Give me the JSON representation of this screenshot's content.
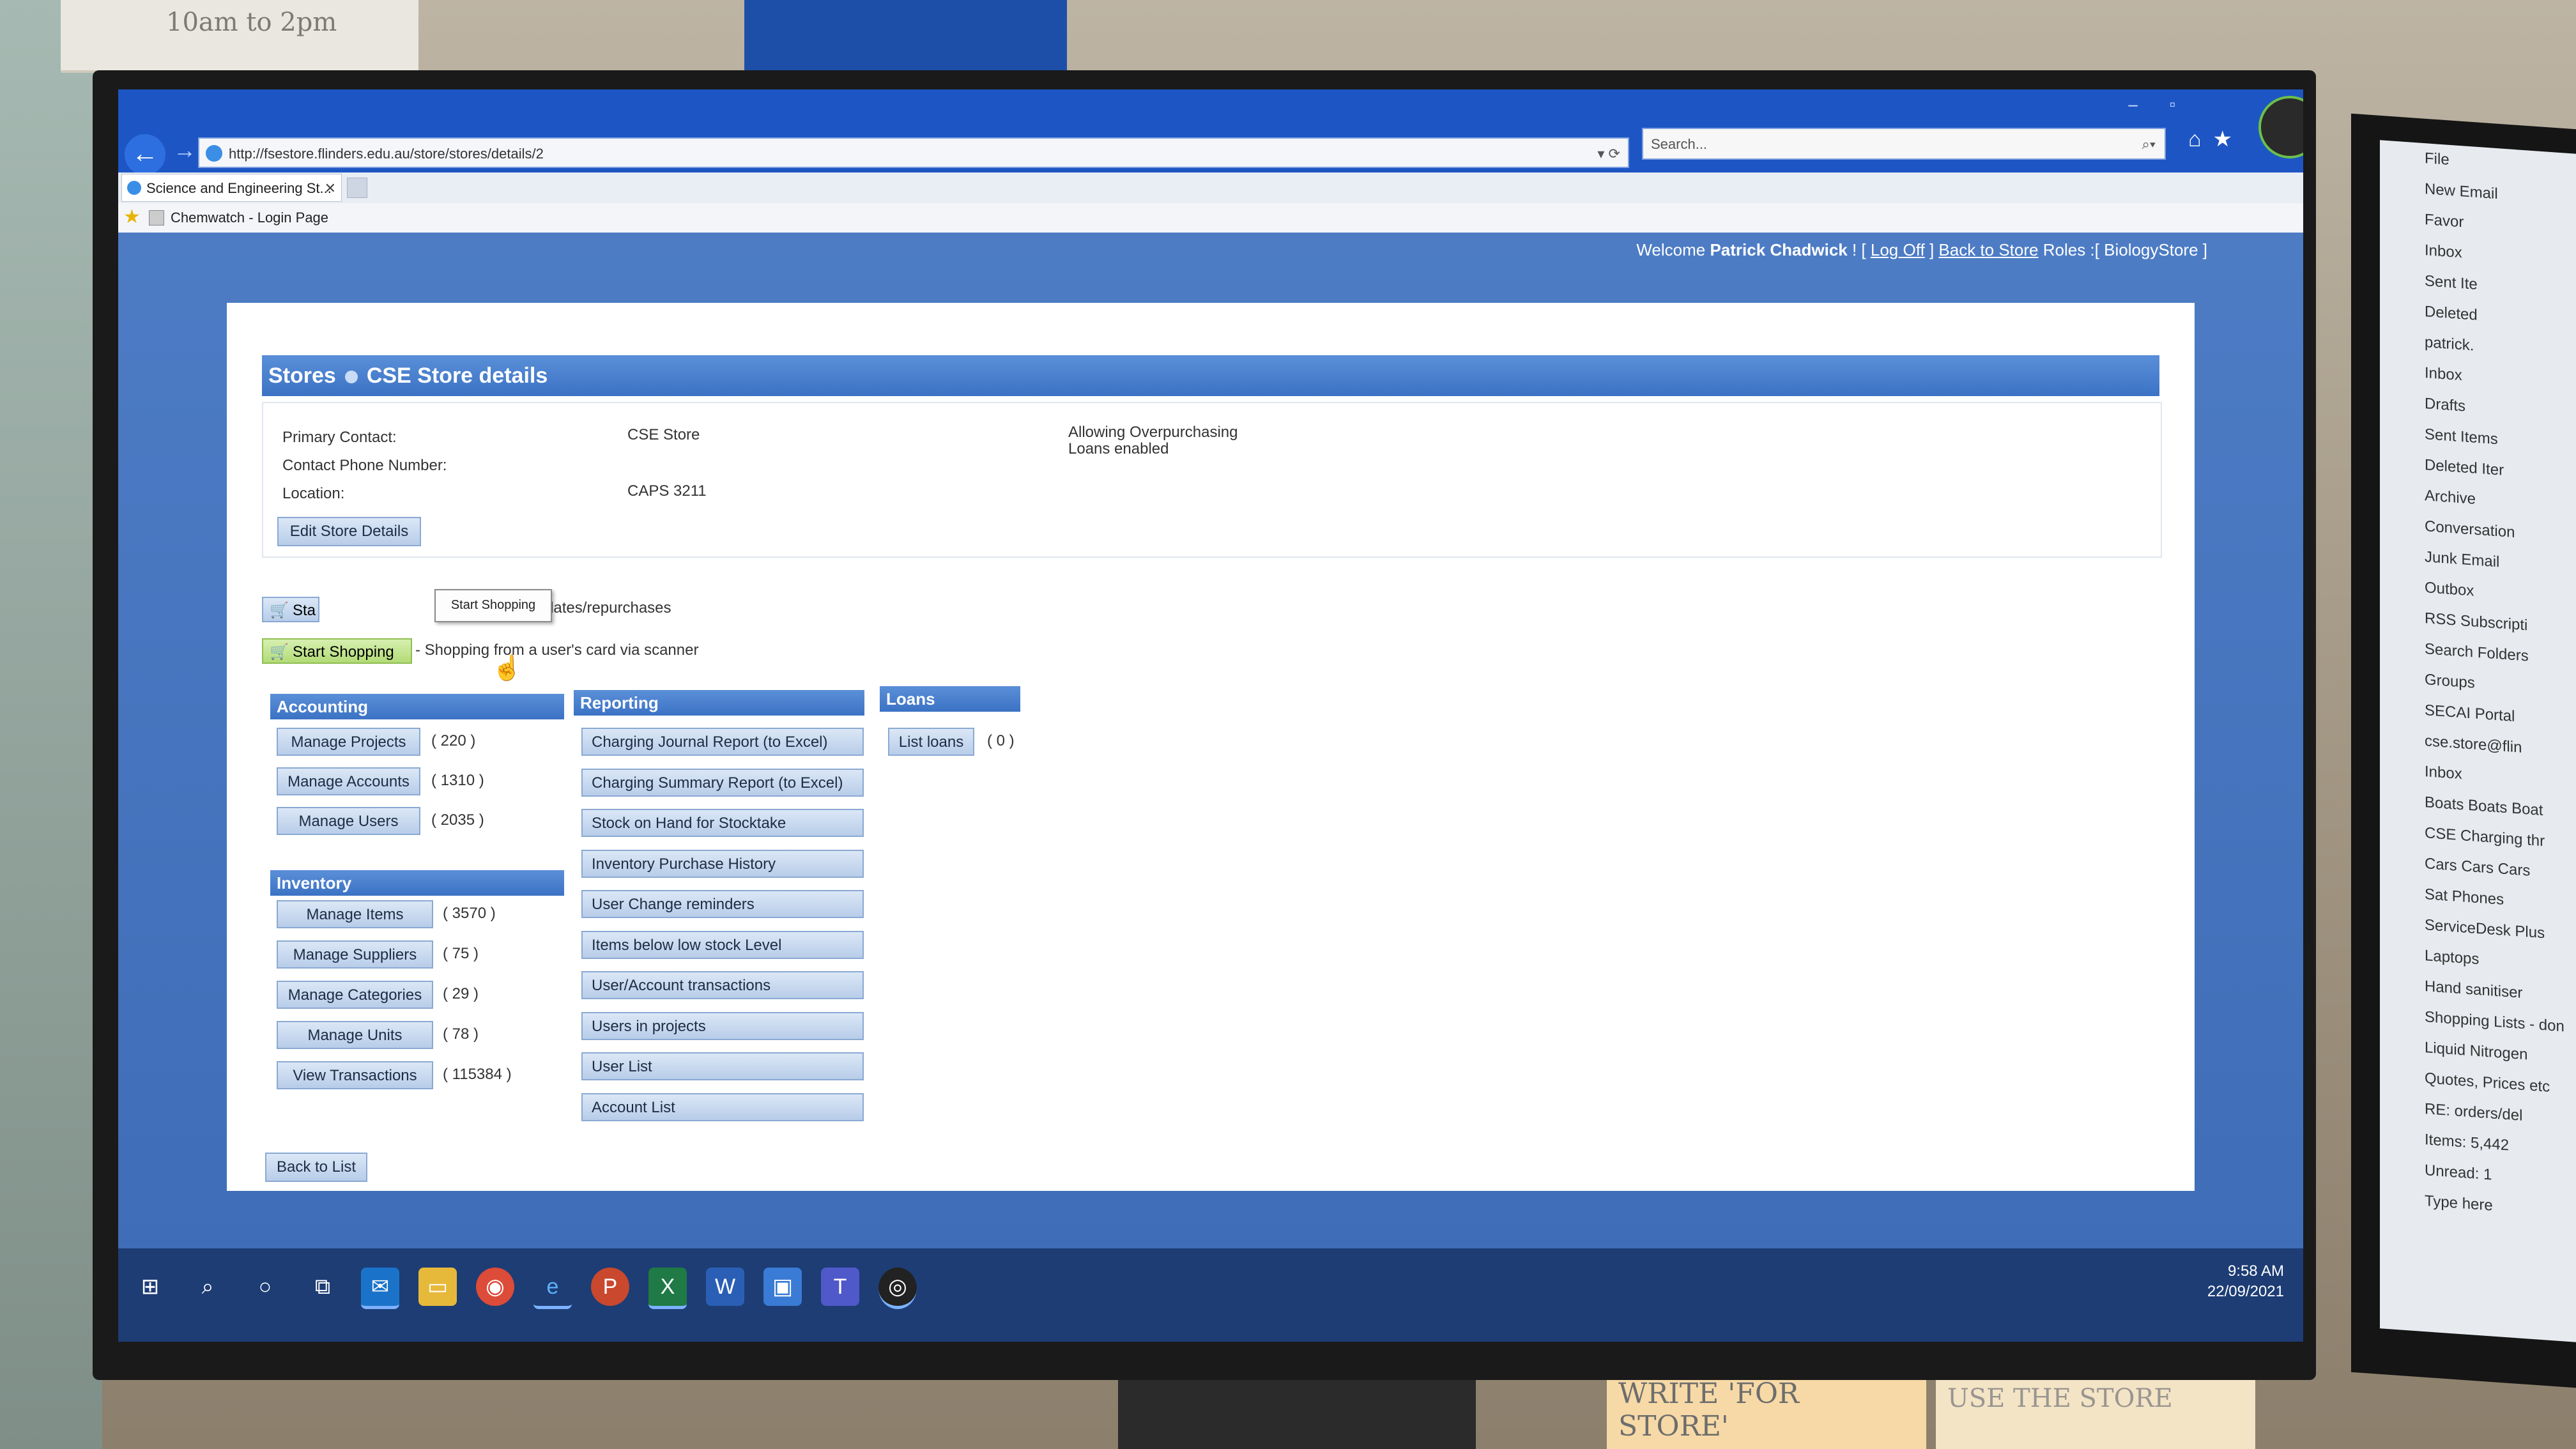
{
  "browser": {
    "url": "http://fsestore.flinders.edu.au/store/stores/details/2",
    "search_placeholder": "Search...",
    "tab_title": "Science and Engineering St...",
    "favorite": "Chemwatch - Login Page"
  },
  "topbar": {
    "welcome": "Welcome",
    "user": "Patrick Chadwick",
    "bang": "! [",
    "logoff": "Log Off",
    "sep": "]",
    "back_to_store": "Back to Store",
    "roles_label": "Roles :[",
    "role": "BiologyStore",
    "roles_end": "]"
  },
  "page": {
    "breadcrumb_stores": "Stores",
    "title": "CSE Store details"
  },
  "details": {
    "primary_contact_label": "Primary Contact:",
    "primary_contact_value": "CSE Store",
    "phone_label": "Contact Phone Number:",
    "location_label": "Location:",
    "location_value": "CAPS 3211",
    "note1": "Allowing Overpurchasing",
    "note2": "Loans enabled",
    "edit_button": "Edit Store Details"
  },
  "shopping": {
    "admin_button": "Sta",
    "admin_desc": "dministrative updates/repurchases",
    "tooltip": "Start Shopping",
    "start_button": "Start Shopping",
    "start_desc": "- Shopping from a user's card via scanner"
  },
  "accounting": {
    "title": "Accounting",
    "items": [
      {
        "label": "Manage Projects",
        "count": "( 220 )"
      },
      {
        "label": "Manage Accounts",
        "count": "( 1310 )"
      },
      {
        "label": "Manage Users",
        "count": "( 2035 )"
      }
    ]
  },
  "inventory": {
    "title": "Inventory",
    "items": [
      {
        "label": "Manage Items",
        "count": "( 3570 )"
      },
      {
        "label": "Manage Suppliers",
        "count": "( 75 )"
      },
      {
        "label": "Manage Categories",
        "count": "( 29 )"
      },
      {
        "label": "Manage Units",
        "count": "( 78 )"
      },
      {
        "label": "View Transactions",
        "count": "( 115384 )"
      }
    ]
  },
  "reporting": {
    "title": "Reporting",
    "items": [
      "Charging Journal Report (to Excel)",
      "Charging Summary Report (to Excel)",
      "Stock on Hand for Stocktake",
      "Inventory Purchase History",
      "User Change reminders",
      "Items below low stock Level",
      "User/Account transactions",
      "Users in projects",
      "User List",
      "Account List"
    ]
  },
  "loans": {
    "title": "Loans",
    "list_button": "List loans",
    "count": "( 0 )"
  },
  "back_to_list": "Back to List",
  "taskbar": {
    "time": "9:58 AM",
    "date": "22/09/2021"
  },
  "surroundings": {
    "sticky_top": "10am to  2pm",
    "note_right1": "MAKE SURE WE WRITE 'FOR STORE'",
    "note_right2": "MAKE SURE YOU USE THE STORE",
    "outlook_items": [
      "File",
      "New Email",
      "Favor",
      "Inbox",
      "Sent Ite",
      "Deleted",
      "patrick.",
      "Inbox",
      "Drafts",
      "Sent Items",
      "Deleted Iter",
      "Archive",
      "Conversation",
      "Junk Email",
      "Outbox",
      "RSS Subscripti",
      "Search Folders",
      "Groups",
      "SECAI Portal",
      "cse.store@flin",
      "Inbox",
      "Boats Boats Boat",
      "CSE Charging thr",
      "Cars Cars Cars",
      "Sat Phones",
      "ServiceDesk Plus",
      "Laptops",
      "Hand sanitiser",
      "Shopping Lists - don",
      "Liquid Nitrogen",
      "Quotes, Prices etc",
      "RE: orders/del",
      "Items: 5,442",
      "Unread: 1",
      "Type here"
    ]
  }
}
